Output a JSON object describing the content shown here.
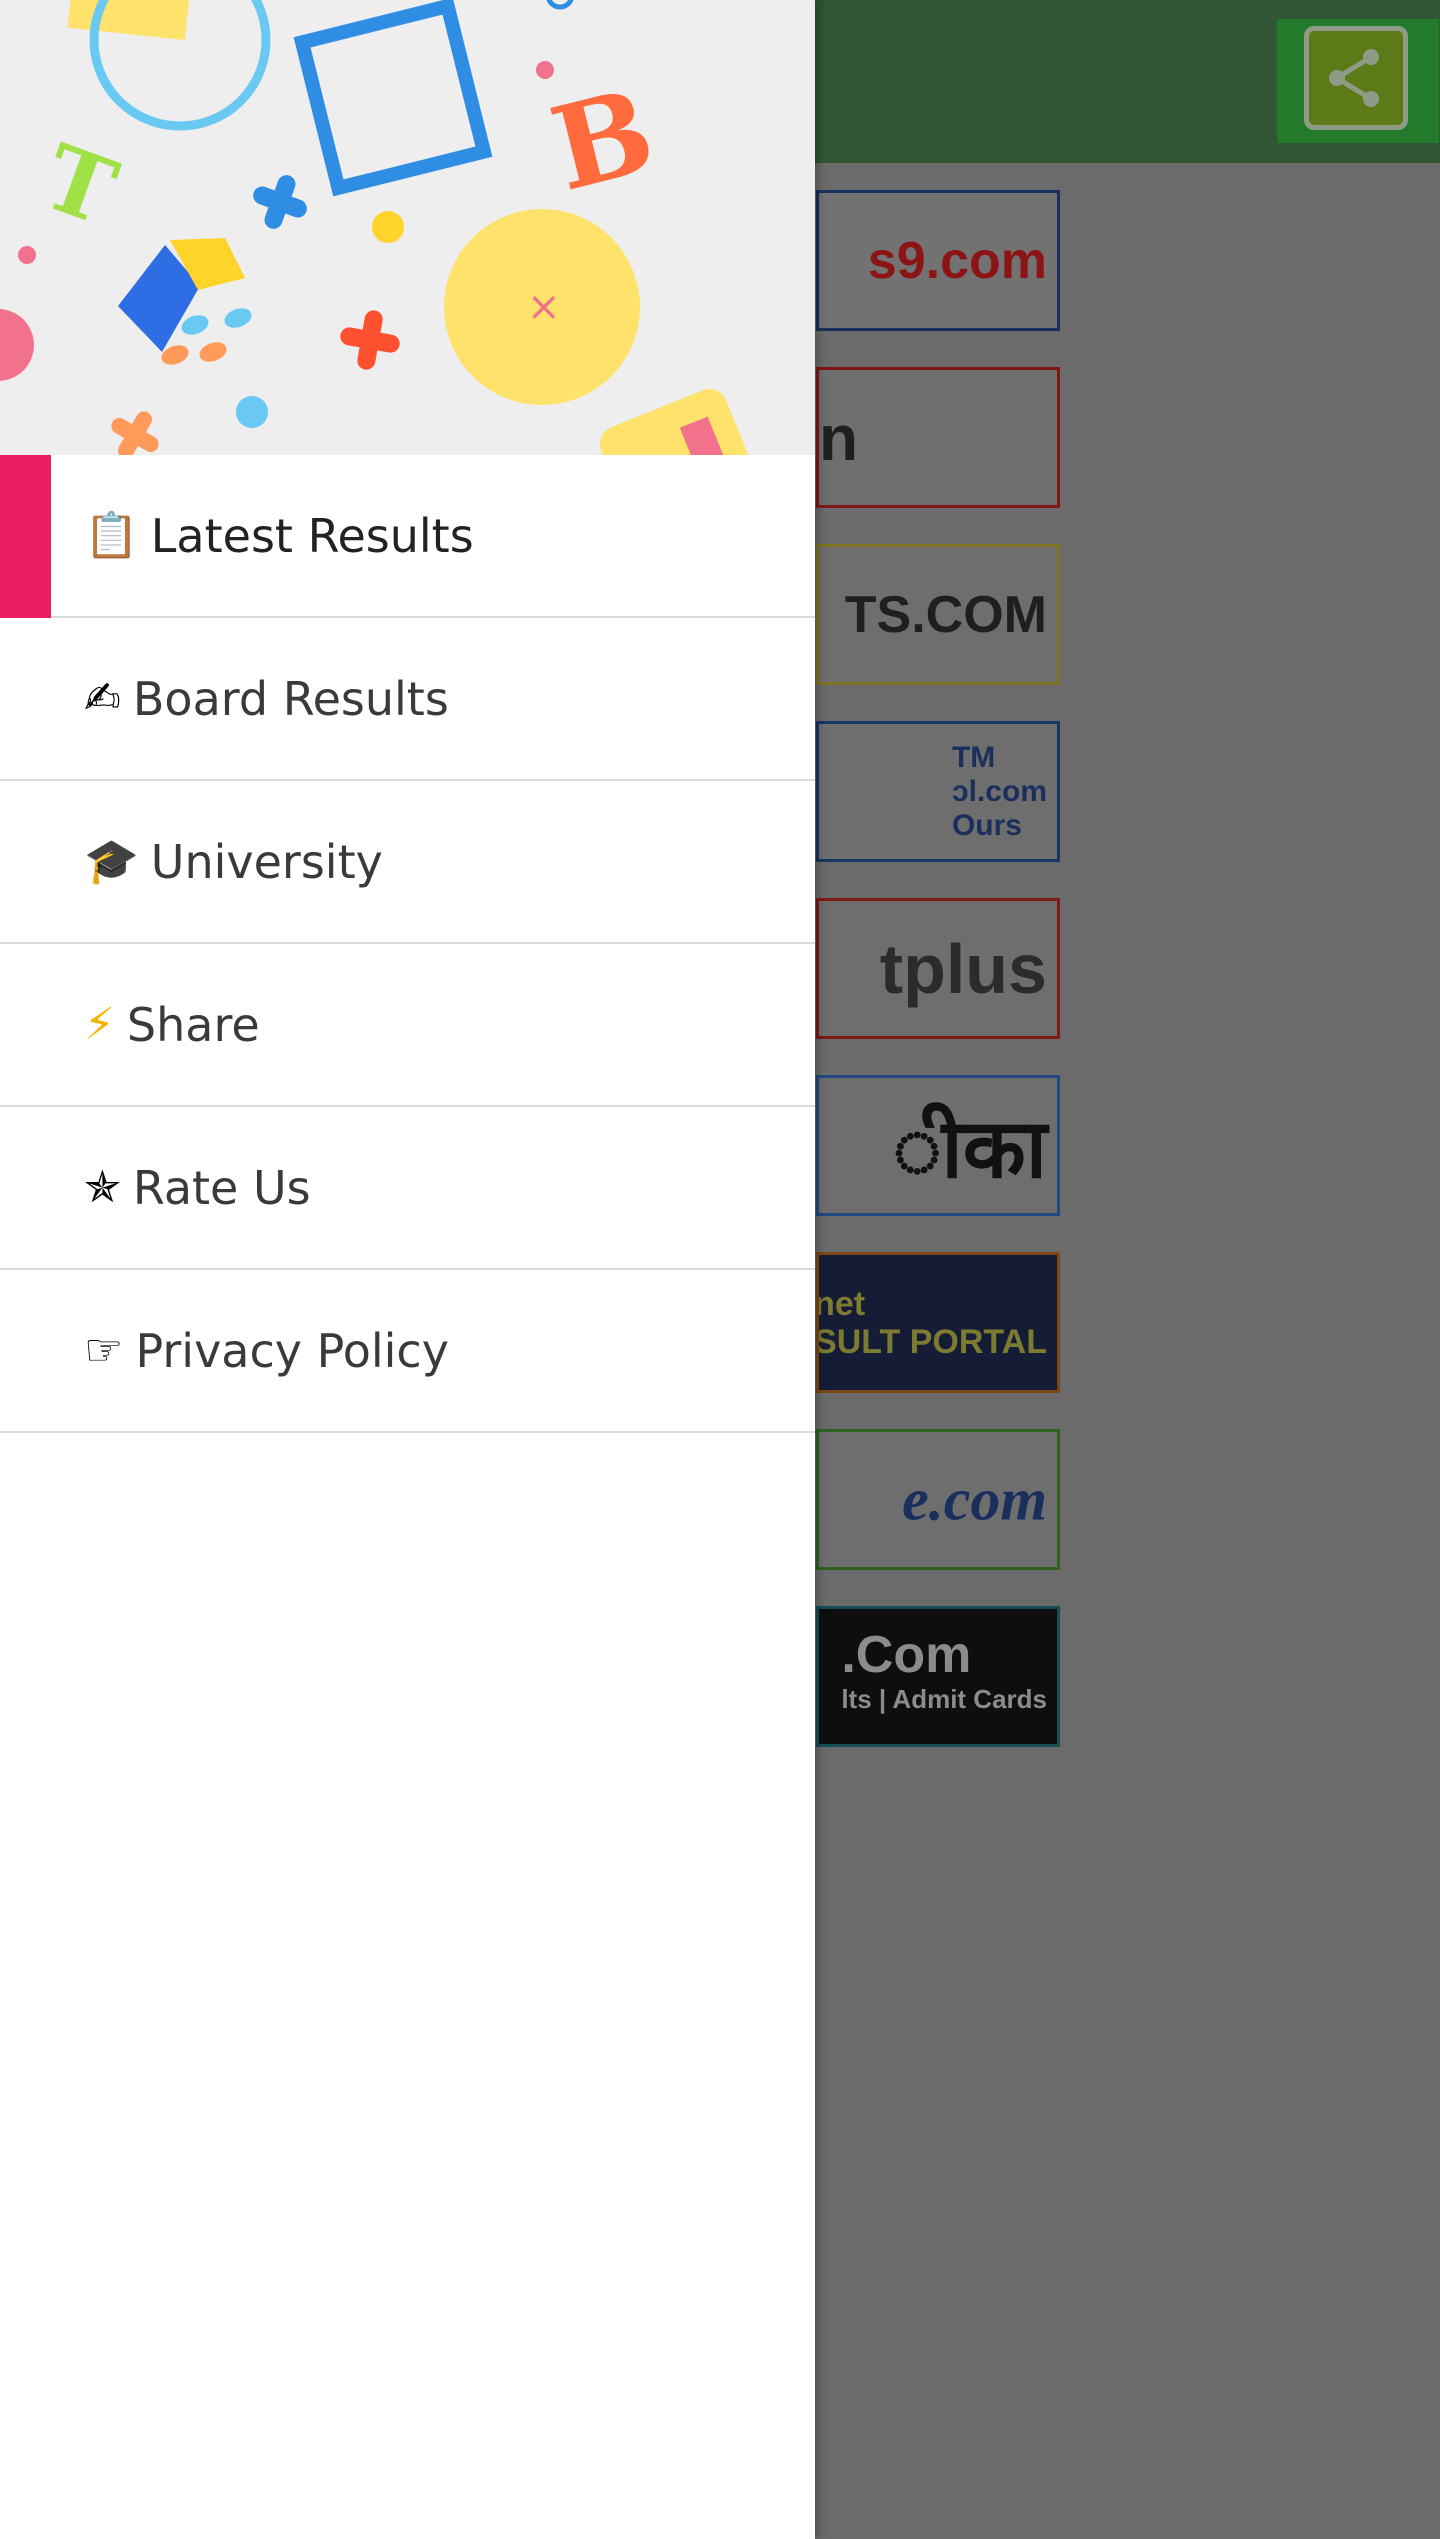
{
  "app": {
    "toolbar": {
      "share_icon": "share-icon"
    },
    "banners": [
      {
        "text": "s9.com"
      },
      {
        "text": "n"
      },
      {
        "text": "TS.COM"
      },
      {
        "text": "TM\nɔl.com\nOurs"
      },
      {
        "text": "tplus"
      },
      {
        "text": "ीका"
      },
      {
        "text": "cs.net\nRESULT PORTAL"
      },
      {
        "text": "e.com"
      },
      {
        "text": ".Com",
        "sub": "lts | Admit Cards"
      }
    ]
  },
  "drawer": {
    "accent_color": "#e91e63",
    "menu": [
      {
        "icon": "clipboard-icon",
        "emoji": "📋",
        "label": "Latest Results",
        "active": true
      },
      {
        "icon": "writing-hand-icon",
        "emoji": "✍",
        "label": "Board Results",
        "active": false
      },
      {
        "icon": "graduation-cap-icon",
        "emoji": "🎓",
        "label": "University",
        "active": false
      },
      {
        "icon": "lightning-icon",
        "emoji": "⚡",
        "label": "Share",
        "active": false
      },
      {
        "icon": "star-icon",
        "emoji": "✯",
        "label": "Rate Us",
        "active": false
      },
      {
        "icon": "pointing-hand-icon",
        "emoji": "☞",
        "label": "Privacy Policy",
        "active": false
      }
    ]
  }
}
